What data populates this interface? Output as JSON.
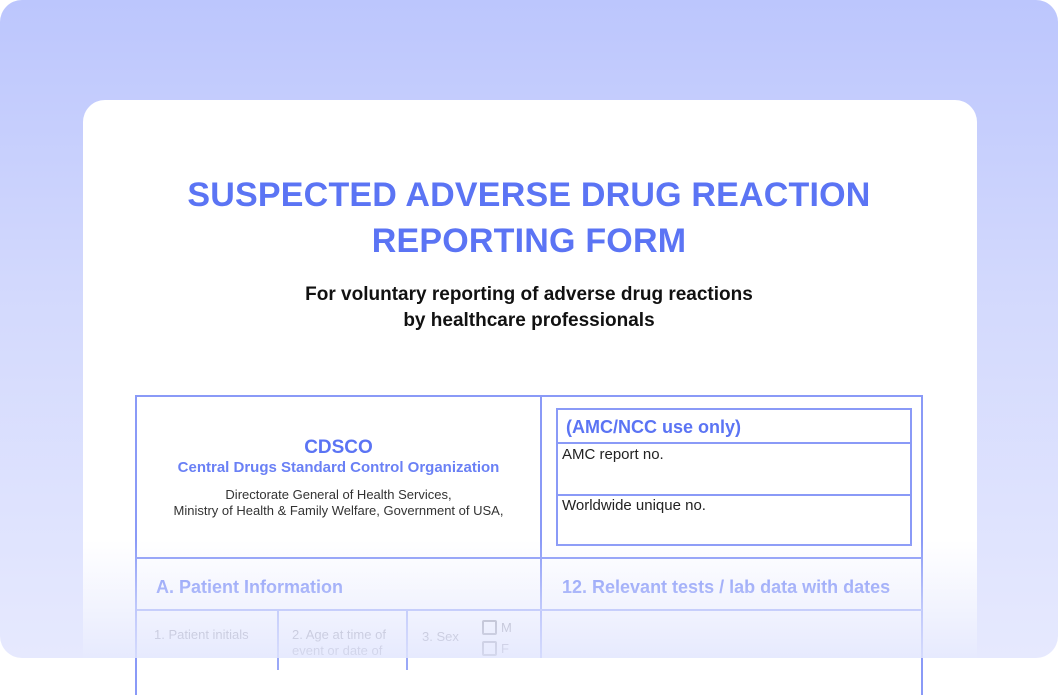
{
  "form": {
    "title_line1": "SUSPECTED ADVERSE DRUG REACTION",
    "title_line2": "REPORTING FORM",
    "subtitle_line1": "For voluntary reporting of adverse drug reactions",
    "subtitle_line2": "by healthcare professionals"
  },
  "org": {
    "name": "CDSCO",
    "full_name": "Central Drugs Standard Control Organization",
    "line1": "Directorate General of Health Services,",
    "line2": "Ministry of Health & Family Welfare, Government of USA,"
  },
  "amc": {
    "header": "(AMC/NCC use only)",
    "report_no_label": "AMC report no.",
    "unique_no_label": "Worldwide unique no."
  },
  "sections": {
    "patient_info": "A. Patient Information",
    "lab_data": "12. Relevant tests / lab data with dates"
  },
  "fields": {
    "patient_initials": "1. Patient initials",
    "age_line1": "2. Age at time of",
    "age_line2": "event or date of",
    "sex": "3. Sex",
    "sex_m": "M",
    "sex_f": "F"
  },
  "colors": {
    "accent": "#5b74f4",
    "border": "#8a9af7",
    "background": "#bcc6fd"
  }
}
